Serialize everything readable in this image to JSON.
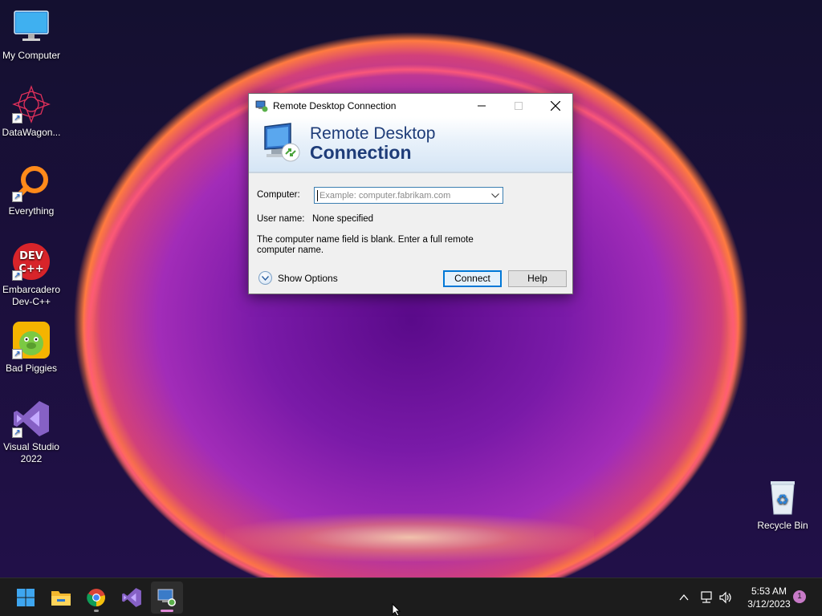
{
  "desktop": {
    "icons": [
      {
        "label": "My Computer"
      },
      {
        "label": "DataWagon..."
      },
      {
        "label": "Everything"
      },
      {
        "label": "Embarcadero Dev-C++"
      },
      {
        "label": "Bad Piggies"
      },
      {
        "label": "Visual Studio 2022"
      },
      {
        "label": "Recycle Bin"
      }
    ]
  },
  "dialog": {
    "title": "Remote Desktop Connection",
    "banner_line1": "Remote Desktop",
    "banner_line2": "Connection",
    "computer_label": "Computer:",
    "computer_placeholder": "Example: computer.fabrikam.com",
    "username_label": "User name:",
    "username_value": "None specified",
    "message": "The computer name field is blank. Enter a full remote computer name.",
    "show_options": "Show Options",
    "connect_button": "Connect",
    "help_button": "Help"
  },
  "taskbar": {
    "apps": [
      "start",
      "file-explorer",
      "chrome",
      "visual-studio",
      "remote-desktop"
    ],
    "time": "5:53 AM",
    "date": "3/12/2023",
    "notification_count": "1"
  },
  "colors": {
    "accent": "#0078d7",
    "banner_text": "#1e3c78"
  }
}
